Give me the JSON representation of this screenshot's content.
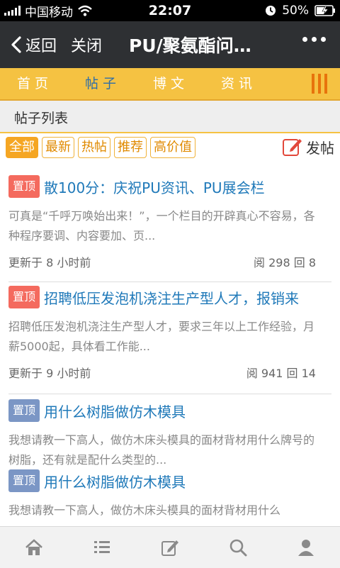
{
  "status_bar": {
    "carrier": "中国移动",
    "time": "22:07",
    "battery": "50%",
    "icons": [
      "signal-icon",
      "wifi-icon",
      "alarm-icon",
      "battery-icon"
    ]
  },
  "nav": {
    "back_label": "返回",
    "close_label": "关闭",
    "title": "PU/聚氨酯问…",
    "icons": [
      "back-arrow-icon",
      "more-icon"
    ]
  },
  "tabs": [
    {
      "label": "首页",
      "active": false
    },
    {
      "label": "帖子",
      "active": true
    },
    {
      "label": "博文",
      "active": false
    },
    {
      "label": "资讯",
      "active": false
    }
  ],
  "section_title": "帖子列表",
  "filters": [
    {
      "label": "全部",
      "active": true
    },
    {
      "label": "最新",
      "active": false
    },
    {
      "label": "热帖",
      "active": false
    },
    {
      "label": "推荐",
      "active": false
    },
    {
      "label": "高价值",
      "active": false
    }
  ],
  "post_button": {
    "label": "发帖",
    "icon": "edit-icon"
  },
  "posts": [
    {
      "badge": "置顶",
      "badge_color": "#f46a5e",
      "title": "散100分：庆祝PU资讯、PU展会栏",
      "excerpt": "可真是“千呼万唤始出来！”，一个栏目的开辟真心不容易，各种程序要调、内容要加、页...",
      "updated": "更新于 8 小时前",
      "stats": "阅 298 回 8"
    },
    {
      "badge": "置顶",
      "badge_color": "#f46a5e",
      "title": "招聘低压发泡机浇注生产型人才，报销来",
      "excerpt": "招聘低压发泡机浇注生产型人才，要求三年以上工作经验，月薪5000起，具体看工作能...",
      "updated": "更新于 9 小时前",
      "stats": "阅 941 回 14"
    },
    {
      "badge": "置顶",
      "badge_color": "#7b96c5",
      "title": "用什么树脂做仿木模具",
      "excerpt": "我想请教一下高人，做仿木床头模具的面材背材用什么牌号的树脂，还有就是配什么类型的..."
    },
    {
      "badge": "置顶",
      "badge_color": "#7b96c5",
      "title": "用什么树脂做仿木模具",
      "excerpt": "我想请教一下高人，做仿木床头模具的面材背材用什么"
    }
  ],
  "bottom_nav": [
    {
      "icon": "home-icon"
    },
    {
      "icon": "list-icon"
    },
    {
      "icon": "compose-icon"
    },
    {
      "icon": "search-icon"
    },
    {
      "icon": "user-icon"
    }
  ],
  "colors": {
    "tab_bar": "#f5c242",
    "nav_bar": "#2e3033",
    "link": "#1f79b9",
    "accent": "#f5a623"
  }
}
